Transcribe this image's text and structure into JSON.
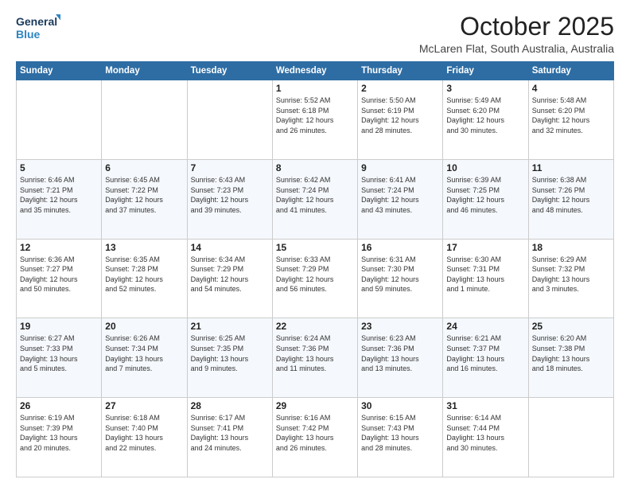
{
  "logo": {
    "line1": "General",
    "line2": "Blue"
  },
  "title": "October 2025",
  "subtitle": "McLaren Flat, South Australia, Australia",
  "weekdays": [
    "Sunday",
    "Monday",
    "Tuesday",
    "Wednesday",
    "Thursday",
    "Friday",
    "Saturday"
  ],
  "weeks": [
    [
      {
        "day": "",
        "info": ""
      },
      {
        "day": "",
        "info": ""
      },
      {
        "day": "",
        "info": ""
      },
      {
        "day": "1",
        "info": "Sunrise: 5:52 AM\nSunset: 6:18 PM\nDaylight: 12 hours\nand 26 minutes."
      },
      {
        "day": "2",
        "info": "Sunrise: 5:50 AM\nSunset: 6:19 PM\nDaylight: 12 hours\nand 28 minutes."
      },
      {
        "day": "3",
        "info": "Sunrise: 5:49 AM\nSunset: 6:20 PM\nDaylight: 12 hours\nand 30 minutes."
      },
      {
        "day": "4",
        "info": "Sunrise: 5:48 AM\nSunset: 6:20 PM\nDaylight: 12 hours\nand 32 minutes."
      }
    ],
    [
      {
        "day": "5",
        "info": "Sunrise: 6:46 AM\nSunset: 7:21 PM\nDaylight: 12 hours\nand 35 minutes."
      },
      {
        "day": "6",
        "info": "Sunrise: 6:45 AM\nSunset: 7:22 PM\nDaylight: 12 hours\nand 37 minutes."
      },
      {
        "day": "7",
        "info": "Sunrise: 6:43 AM\nSunset: 7:23 PM\nDaylight: 12 hours\nand 39 minutes."
      },
      {
        "day": "8",
        "info": "Sunrise: 6:42 AM\nSunset: 7:24 PM\nDaylight: 12 hours\nand 41 minutes."
      },
      {
        "day": "9",
        "info": "Sunrise: 6:41 AM\nSunset: 7:24 PM\nDaylight: 12 hours\nand 43 minutes."
      },
      {
        "day": "10",
        "info": "Sunrise: 6:39 AM\nSunset: 7:25 PM\nDaylight: 12 hours\nand 46 minutes."
      },
      {
        "day": "11",
        "info": "Sunrise: 6:38 AM\nSunset: 7:26 PM\nDaylight: 12 hours\nand 48 minutes."
      }
    ],
    [
      {
        "day": "12",
        "info": "Sunrise: 6:36 AM\nSunset: 7:27 PM\nDaylight: 12 hours\nand 50 minutes."
      },
      {
        "day": "13",
        "info": "Sunrise: 6:35 AM\nSunset: 7:28 PM\nDaylight: 12 hours\nand 52 minutes."
      },
      {
        "day": "14",
        "info": "Sunrise: 6:34 AM\nSunset: 7:29 PM\nDaylight: 12 hours\nand 54 minutes."
      },
      {
        "day": "15",
        "info": "Sunrise: 6:33 AM\nSunset: 7:29 PM\nDaylight: 12 hours\nand 56 minutes."
      },
      {
        "day": "16",
        "info": "Sunrise: 6:31 AM\nSunset: 7:30 PM\nDaylight: 12 hours\nand 59 minutes."
      },
      {
        "day": "17",
        "info": "Sunrise: 6:30 AM\nSunset: 7:31 PM\nDaylight: 13 hours\nand 1 minute."
      },
      {
        "day": "18",
        "info": "Sunrise: 6:29 AM\nSunset: 7:32 PM\nDaylight: 13 hours\nand 3 minutes."
      }
    ],
    [
      {
        "day": "19",
        "info": "Sunrise: 6:27 AM\nSunset: 7:33 PM\nDaylight: 13 hours\nand 5 minutes."
      },
      {
        "day": "20",
        "info": "Sunrise: 6:26 AM\nSunset: 7:34 PM\nDaylight: 13 hours\nand 7 minutes."
      },
      {
        "day": "21",
        "info": "Sunrise: 6:25 AM\nSunset: 7:35 PM\nDaylight: 13 hours\nand 9 minutes."
      },
      {
        "day": "22",
        "info": "Sunrise: 6:24 AM\nSunset: 7:36 PM\nDaylight: 13 hours\nand 11 minutes."
      },
      {
        "day": "23",
        "info": "Sunrise: 6:23 AM\nSunset: 7:36 PM\nDaylight: 13 hours\nand 13 minutes."
      },
      {
        "day": "24",
        "info": "Sunrise: 6:21 AM\nSunset: 7:37 PM\nDaylight: 13 hours\nand 16 minutes."
      },
      {
        "day": "25",
        "info": "Sunrise: 6:20 AM\nSunset: 7:38 PM\nDaylight: 13 hours\nand 18 minutes."
      }
    ],
    [
      {
        "day": "26",
        "info": "Sunrise: 6:19 AM\nSunset: 7:39 PM\nDaylight: 13 hours\nand 20 minutes."
      },
      {
        "day": "27",
        "info": "Sunrise: 6:18 AM\nSunset: 7:40 PM\nDaylight: 13 hours\nand 22 minutes."
      },
      {
        "day": "28",
        "info": "Sunrise: 6:17 AM\nSunset: 7:41 PM\nDaylight: 13 hours\nand 24 minutes."
      },
      {
        "day": "29",
        "info": "Sunrise: 6:16 AM\nSunset: 7:42 PM\nDaylight: 13 hours\nand 26 minutes."
      },
      {
        "day": "30",
        "info": "Sunrise: 6:15 AM\nSunset: 7:43 PM\nDaylight: 13 hours\nand 28 minutes."
      },
      {
        "day": "31",
        "info": "Sunrise: 6:14 AM\nSunset: 7:44 PM\nDaylight: 13 hours\nand 30 minutes."
      },
      {
        "day": "",
        "info": ""
      }
    ]
  ]
}
